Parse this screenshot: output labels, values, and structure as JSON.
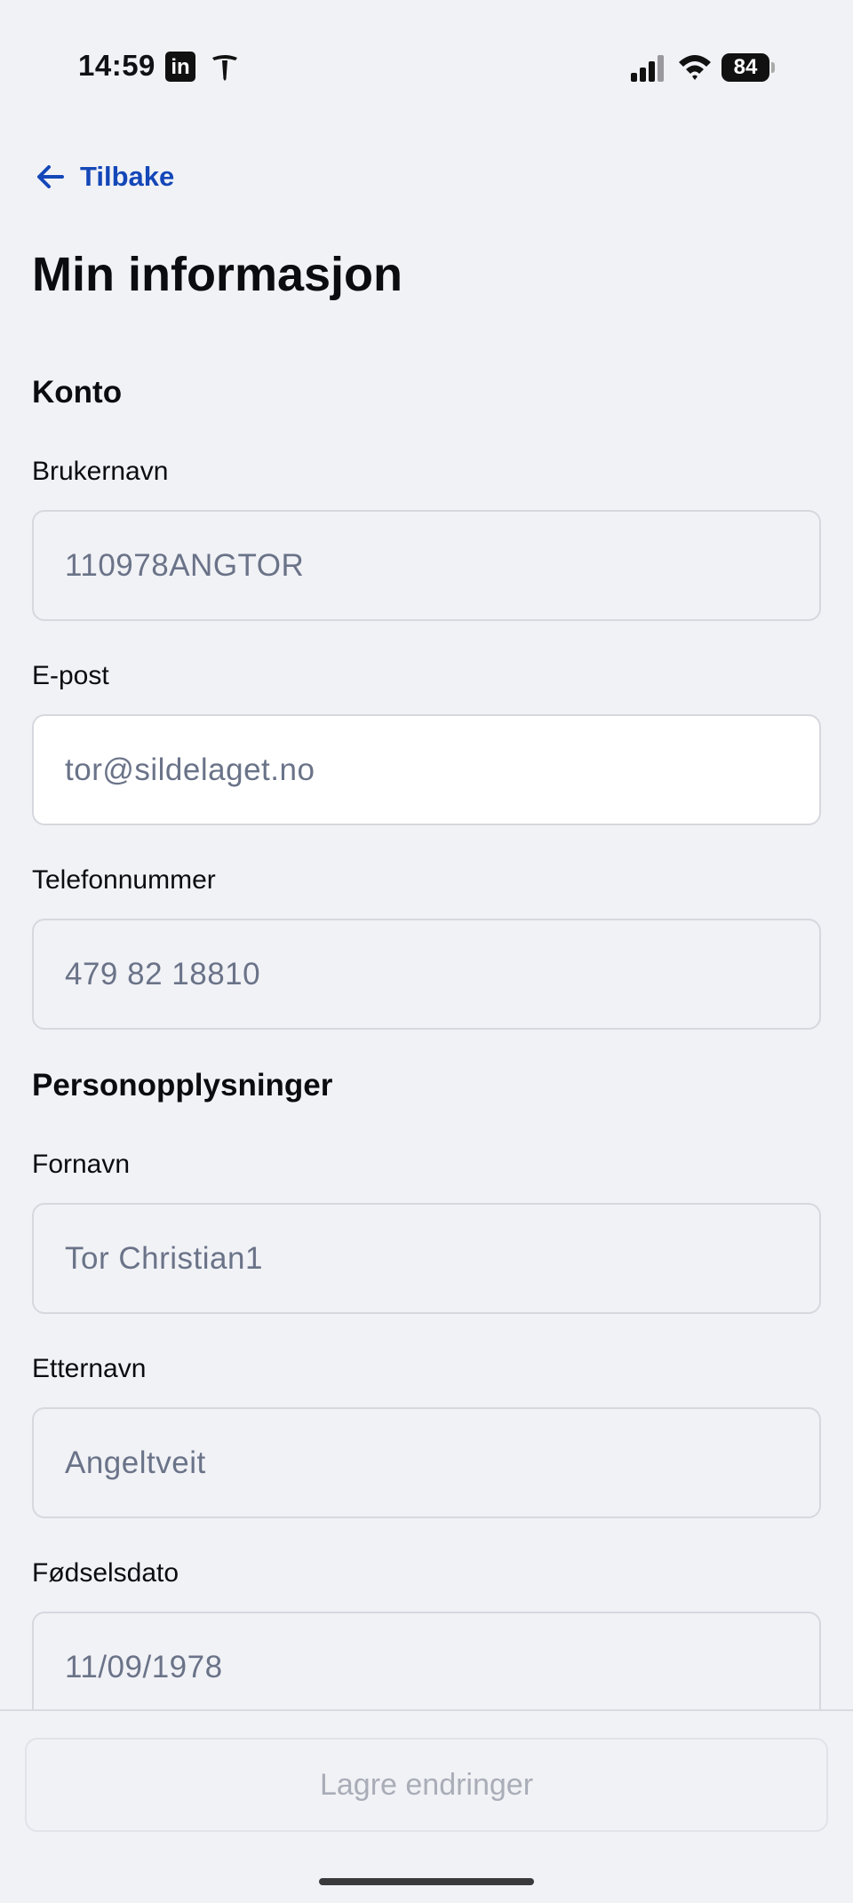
{
  "status_bar": {
    "time": "14:59",
    "battery": "84",
    "icons": [
      "linkedin-icon",
      "tesla-icon",
      "signal-icon",
      "wifi-icon",
      "battery-icon"
    ]
  },
  "nav": {
    "back_label": "Tilbake"
  },
  "page": {
    "title": "Min informasjon"
  },
  "sections": {
    "account": {
      "title": "Konto",
      "username": {
        "label": "Brukernavn",
        "value": "110978ANGTOR"
      },
      "email": {
        "label": "E-post",
        "value": "tor@sildelaget.no"
      },
      "phone": {
        "label": "Telefonnummer",
        "value": "479 82 18810"
      }
    },
    "personal": {
      "title": "Personopplysninger",
      "first_name": {
        "label": "Fornavn",
        "value": "Tor Christian1"
      },
      "last_name": {
        "label": "Etternavn",
        "value": "Angeltveit"
      },
      "birth_date": {
        "label": "Fødselsdato",
        "value": "11/09/1978"
      }
    }
  },
  "footer": {
    "save_label": "Lagre endringer"
  },
  "colors": {
    "accent": "#1447b8",
    "background": "#f1f2f6",
    "field_text": "#6a7388",
    "disabled_text": "#a9adb7"
  }
}
